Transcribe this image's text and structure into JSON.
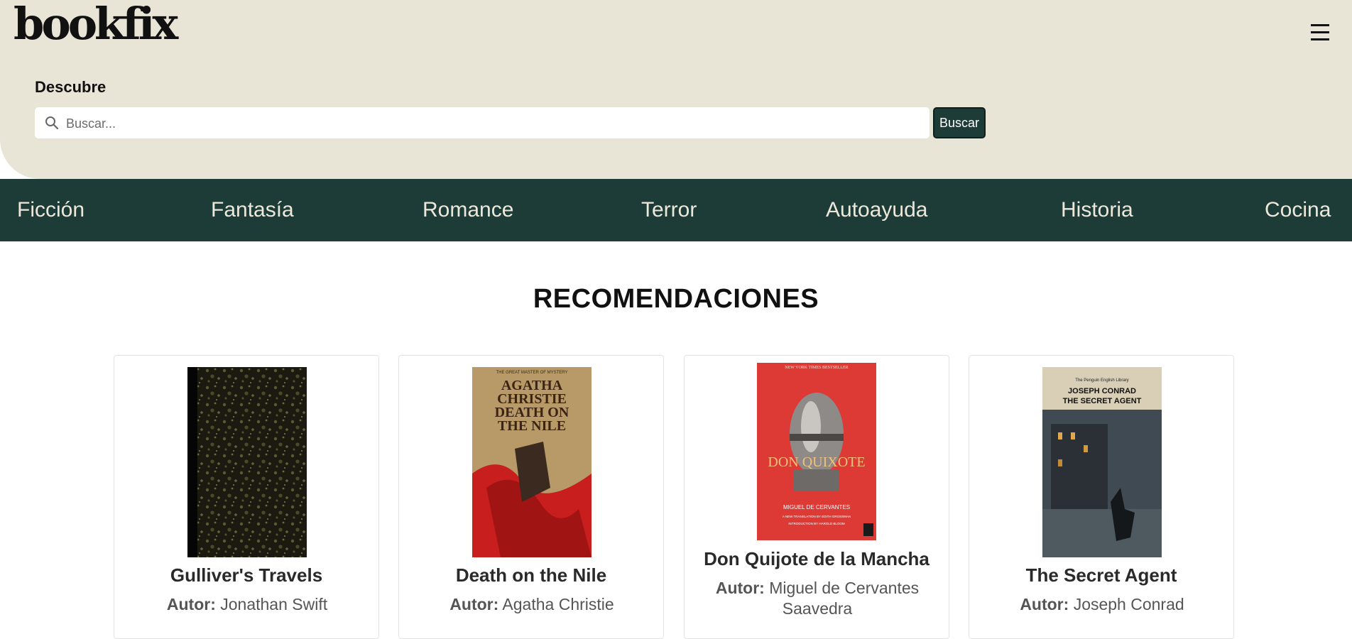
{
  "header": {
    "logo": "bookfix",
    "menu_icon": "hamburger-menu-icon",
    "discover_label": "Descubre",
    "search": {
      "placeholder": "Buscar...",
      "value": "",
      "icon": "search-icon",
      "button_label": "Buscar"
    }
  },
  "categories": [
    "Ficción",
    "Fantasía",
    "Romance",
    "Terror",
    "Autoayuda",
    "Historia",
    "Cocina"
  ],
  "recommendations": {
    "title": "RECOMENDACIONES",
    "author_label": "Autor:",
    "books": [
      {
        "title": "Gulliver's Travels",
        "author": "Jonathan Swift"
      },
      {
        "title": "Death on the Nile",
        "author": "Agatha Christie",
        "cover_text": [
          "THE GREAT MASTER OF MYSTERY",
          "AGATHA",
          "CHRISTIE",
          "DEATH ON",
          "THE NILE"
        ]
      },
      {
        "title": "Don Quijote de la Mancha",
        "author": "Miguel de Cervantes Saavedra",
        "cover_text": [
          "NEW YORK TIMES BESTSELLER",
          "DON QUIXOTE",
          "MIGUEL DE CERVANTES",
          "A NEW TRANSLATION BY EDITH GROSSMAN",
          "INTRODUCTION BY HAROLD BLOOM"
        ]
      },
      {
        "title": "The Secret Agent",
        "author": "Joseph Conrad",
        "cover_text": [
          "The Penguin English Library",
          "JOSEPH CONRAD",
          "THE SECRET AGENT"
        ]
      }
    ]
  },
  "colors": {
    "header_bg": "#e8e4d6",
    "nav_bg": "#1d3c37",
    "nav_text": "#ece8db",
    "button_bg": "#1d3c37"
  }
}
